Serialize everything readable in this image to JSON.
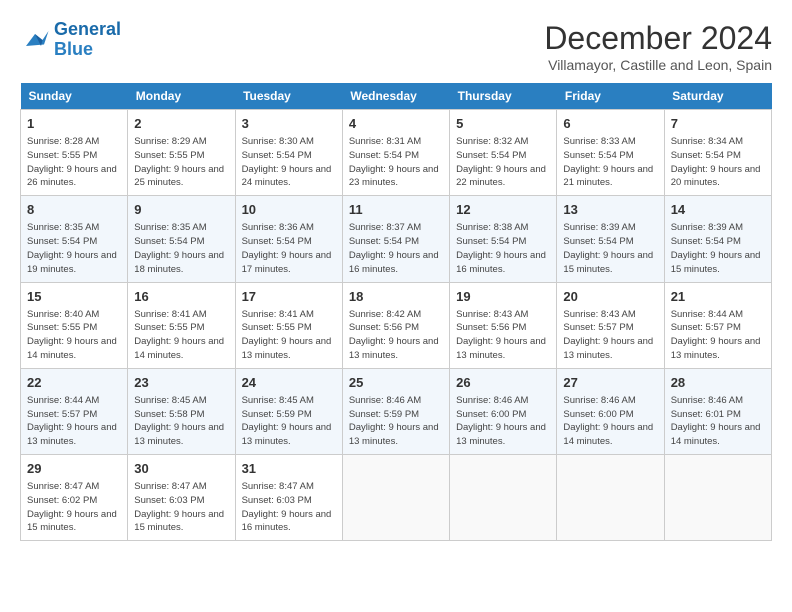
{
  "header": {
    "logo_line1": "General",
    "logo_line2": "Blue",
    "month_title": "December 2024",
    "subtitle": "Villamayor, Castille and Leon, Spain"
  },
  "weekdays": [
    "Sunday",
    "Monday",
    "Tuesday",
    "Wednesday",
    "Thursday",
    "Friday",
    "Saturday"
  ],
  "weeks": [
    [
      {
        "day": "1",
        "sunrise": "Sunrise: 8:28 AM",
        "sunset": "Sunset: 5:55 PM",
        "daylight": "Daylight: 9 hours and 26 minutes."
      },
      {
        "day": "2",
        "sunrise": "Sunrise: 8:29 AM",
        "sunset": "Sunset: 5:55 PM",
        "daylight": "Daylight: 9 hours and 25 minutes."
      },
      {
        "day": "3",
        "sunrise": "Sunrise: 8:30 AM",
        "sunset": "Sunset: 5:54 PM",
        "daylight": "Daylight: 9 hours and 24 minutes."
      },
      {
        "day": "4",
        "sunrise": "Sunrise: 8:31 AM",
        "sunset": "Sunset: 5:54 PM",
        "daylight": "Daylight: 9 hours and 23 minutes."
      },
      {
        "day": "5",
        "sunrise": "Sunrise: 8:32 AM",
        "sunset": "Sunset: 5:54 PM",
        "daylight": "Daylight: 9 hours and 22 minutes."
      },
      {
        "day": "6",
        "sunrise": "Sunrise: 8:33 AM",
        "sunset": "Sunset: 5:54 PM",
        "daylight": "Daylight: 9 hours and 21 minutes."
      },
      {
        "day": "7",
        "sunrise": "Sunrise: 8:34 AM",
        "sunset": "Sunset: 5:54 PM",
        "daylight": "Daylight: 9 hours and 20 minutes."
      }
    ],
    [
      {
        "day": "8",
        "sunrise": "Sunrise: 8:35 AM",
        "sunset": "Sunset: 5:54 PM",
        "daylight": "Daylight: 9 hours and 19 minutes."
      },
      {
        "day": "9",
        "sunrise": "Sunrise: 8:35 AM",
        "sunset": "Sunset: 5:54 PM",
        "daylight": "Daylight: 9 hours and 18 minutes."
      },
      {
        "day": "10",
        "sunrise": "Sunrise: 8:36 AM",
        "sunset": "Sunset: 5:54 PM",
        "daylight": "Daylight: 9 hours and 17 minutes."
      },
      {
        "day": "11",
        "sunrise": "Sunrise: 8:37 AM",
        "sunset": "Sunset: 5:54 PM",
        "daylight": "Daylight: 9 hours and 16 minutes."
      },
      {
        "day": "12",
        "sunrise": "Sunrise: 8:38 AM",
        "sunset": "Sunset: 5:54 PM",
        "daylight": "Daylight: 9 hours and 16 minutes."
      },
      {
        "day": "13",
        "sunrise": "Sunrise: 8:39 AM",
        "sunset": "Sunset: 5:54 PM",
        "daylight": "Daylight: 9 hours and 15 minutes."
      },
      {
        "day": "14",
        "sunrise": "Sunrise: 8:39 AM",
        "sunset": "Sunset: 5:54 PM",
        "daylight": "Daylight: 9 hours and 15 minutes."
      }
    ],
    [
      {
        "day": "15",
        "sunrise": "Sunrise: 8:40 AM",
        "sunset": "Sunset: 5:55 PM",
        "daylight": "Daylight: 9 hours and 14 minutes."
      },
      {
        "day": "16",
        "sunrise": "Sunrise: 8:41 AM",
        "sunset": "Sunset: 5:55 PM",
        "daylight": "Daylight: 9 hours and 14 minutes."
      },
      {
        "day": "17",
        "sunrise": "Sunrise: 8:41 AM",
        "sunset": "Sunset: 5:55 PM",
        "daylight": "Daylight: 9 hours and 13 minutes."
      },
      {
        "day": "18",
        "sunrise": "Sunrise: 8:42 AM",
        "sunset": "Sunset: 5:56 PM",
        "daylight": "Daylight: 9 hours and 13 minutes."
      },
      {
        "day": "19",
        "sunrise": "Sunrise: 8:43 AM",
        "sunset": "Sunset: 5:56 PM",
        "daylight": "Daylight: 9 hours and 13 minutes."
      },
      {
        "day": "20",
        "sunrise": "Sunrise: 8:43 AM",
        "sunset": "Sunset: 5:57 PM",
        "daylight": "Daylight: 9 hours and 13 minutes."
      },
      {
        "day": "21",
        "sunrise": "Sunrise: 8:44 AM",
        "sunset": "Sunset: 5:57 PM",
        "daylight": "Daylight: 9 hours and 13 minutes."
      }
    ],
    [
      {
        "day": "22",
        "sunrise": "Sunrise: 8:44 AM",
        "sunset": "Sunset: 5:57 PM",
        "daylight": "Daylight: 9 hours and 13 minutes."
      },
      {
        "day": "23",
        "sunrise": "Sunrise: 8:45 AM",
        "sunset": "Sunset: 5:58 PM",
        "daylight": "Daylight: 9 hours and 13 minutes."
      },
      {
        "day": "24",
        "sunrise": "Sunrise: 8:45 AM",
        "sunset": "Sunset: 5:59 PM",
        "daylight": "Daylight: 9 hours and 13 minutes."
      },
      {
        "day": "25",
        "sunrise": "Sunrise: 8:46 AM",
        "sunset": "Sunset: 5:59 PM",
        "daylight": "Daylight: 9 hours and 13 minutes."
      },
      {
        "day": "26",
        "sunrise": "Sunrise: 8:46 AM",
        "sunset": "Sunset: 6:00 PM",
        "daylight": "Daylight: 9 hours and 13 minutes."
      },
      {
        "day": "27",
        "sunrise": "Sunrise: 8:46 AM",
        "sunset": "Sunset: 6:00 PM",
        "daylight": "Daylight: 9 hours and 14 minutes."
      },
      {
        "day": "28",
        "sunrise": "Sunrise: 8:46 AM",
        "sunset": "Sunset: 6:01 PM",
        "daylight": "Daylight: 9 hours and 14 minutes."
      }
    ],
    [
      {
        "day": "29",
        "sunrise": "Sunrise: 8:47 AM",
        "sunset": "Sunset: 6:02 PM",
        "daylight": "Daylight: 9 hours and 15 minutes."
      },
      {
        "day": "30",
        "sunrise": "Sunrise: 8:47 AM",
        "sunset": "Sunset: 6:03 PM",
        "daylight": "Daylight: 9 hours and 15 minutes."
      },
      {
        "day": "31",
        "sunrise": "Sunrise: 8:47 AM",
        "sunset": "Sunset: 6:03 PM",
        "daylight": "Daylight: 9 hours and 16 minutes."
      },
      null,
      null,
      null,
      null
    ]
  ]
}
